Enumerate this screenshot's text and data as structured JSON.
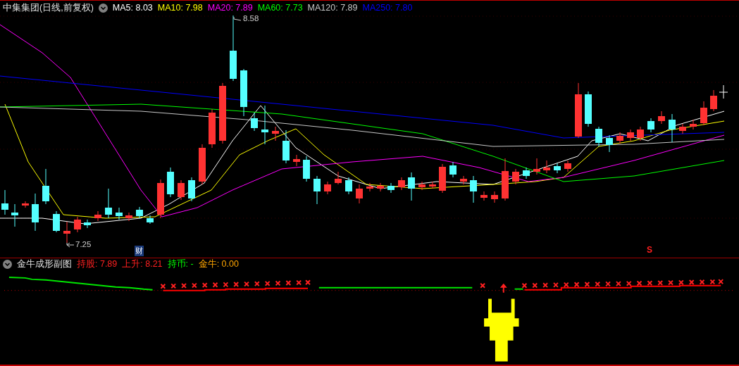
{
  "main_chart": {
    "title": "中集集团(日线,前复权)",
    "ma_legend": [
      {
        "label": "MA5:",
        "value": "8.03",
        "color": "#ffffff"
      },
      {
        "label": "MA10:",
        "value": "7.98",
        "color": "#ffff00"
      },
      {
        "label": "MA20:",
        "value": "7.89",
        "color": "#ff00ff"
      },
      {
        "label": "MA60:",
        "value": "7.73",
        "color": "#00ff00"
      },
      {
        "label": "MA120:",
        "value": "7.89",
        "color": "#c8c8c8"
      },
      {
        "label": "MA250:",
        "value": "7.80",
        "color": "#0000ff"
      }
    ],
    "high_label": "8.58",
    "low_label": "7.25",
    "event_tag": "财",
    "signal_mark": "S"
  },
  "sub_chart": {
    "title": "金牛成形副图",
    "readouts": [
      {
        "label": "持股:",
        "value": "7.89",
        "color": "#ff2020"
      },
      {
        "label": "上升:",
        "value": "8.21",
        "color": "#ff2020"
      },
      {
        "label": "持币:",
        "value": "-",
        "color": "#00ff00"
      },
      {
        "label": "金牛:",
        "value": "0.00",
        "color": "#ffa500"
      }
    ]
  }
}
